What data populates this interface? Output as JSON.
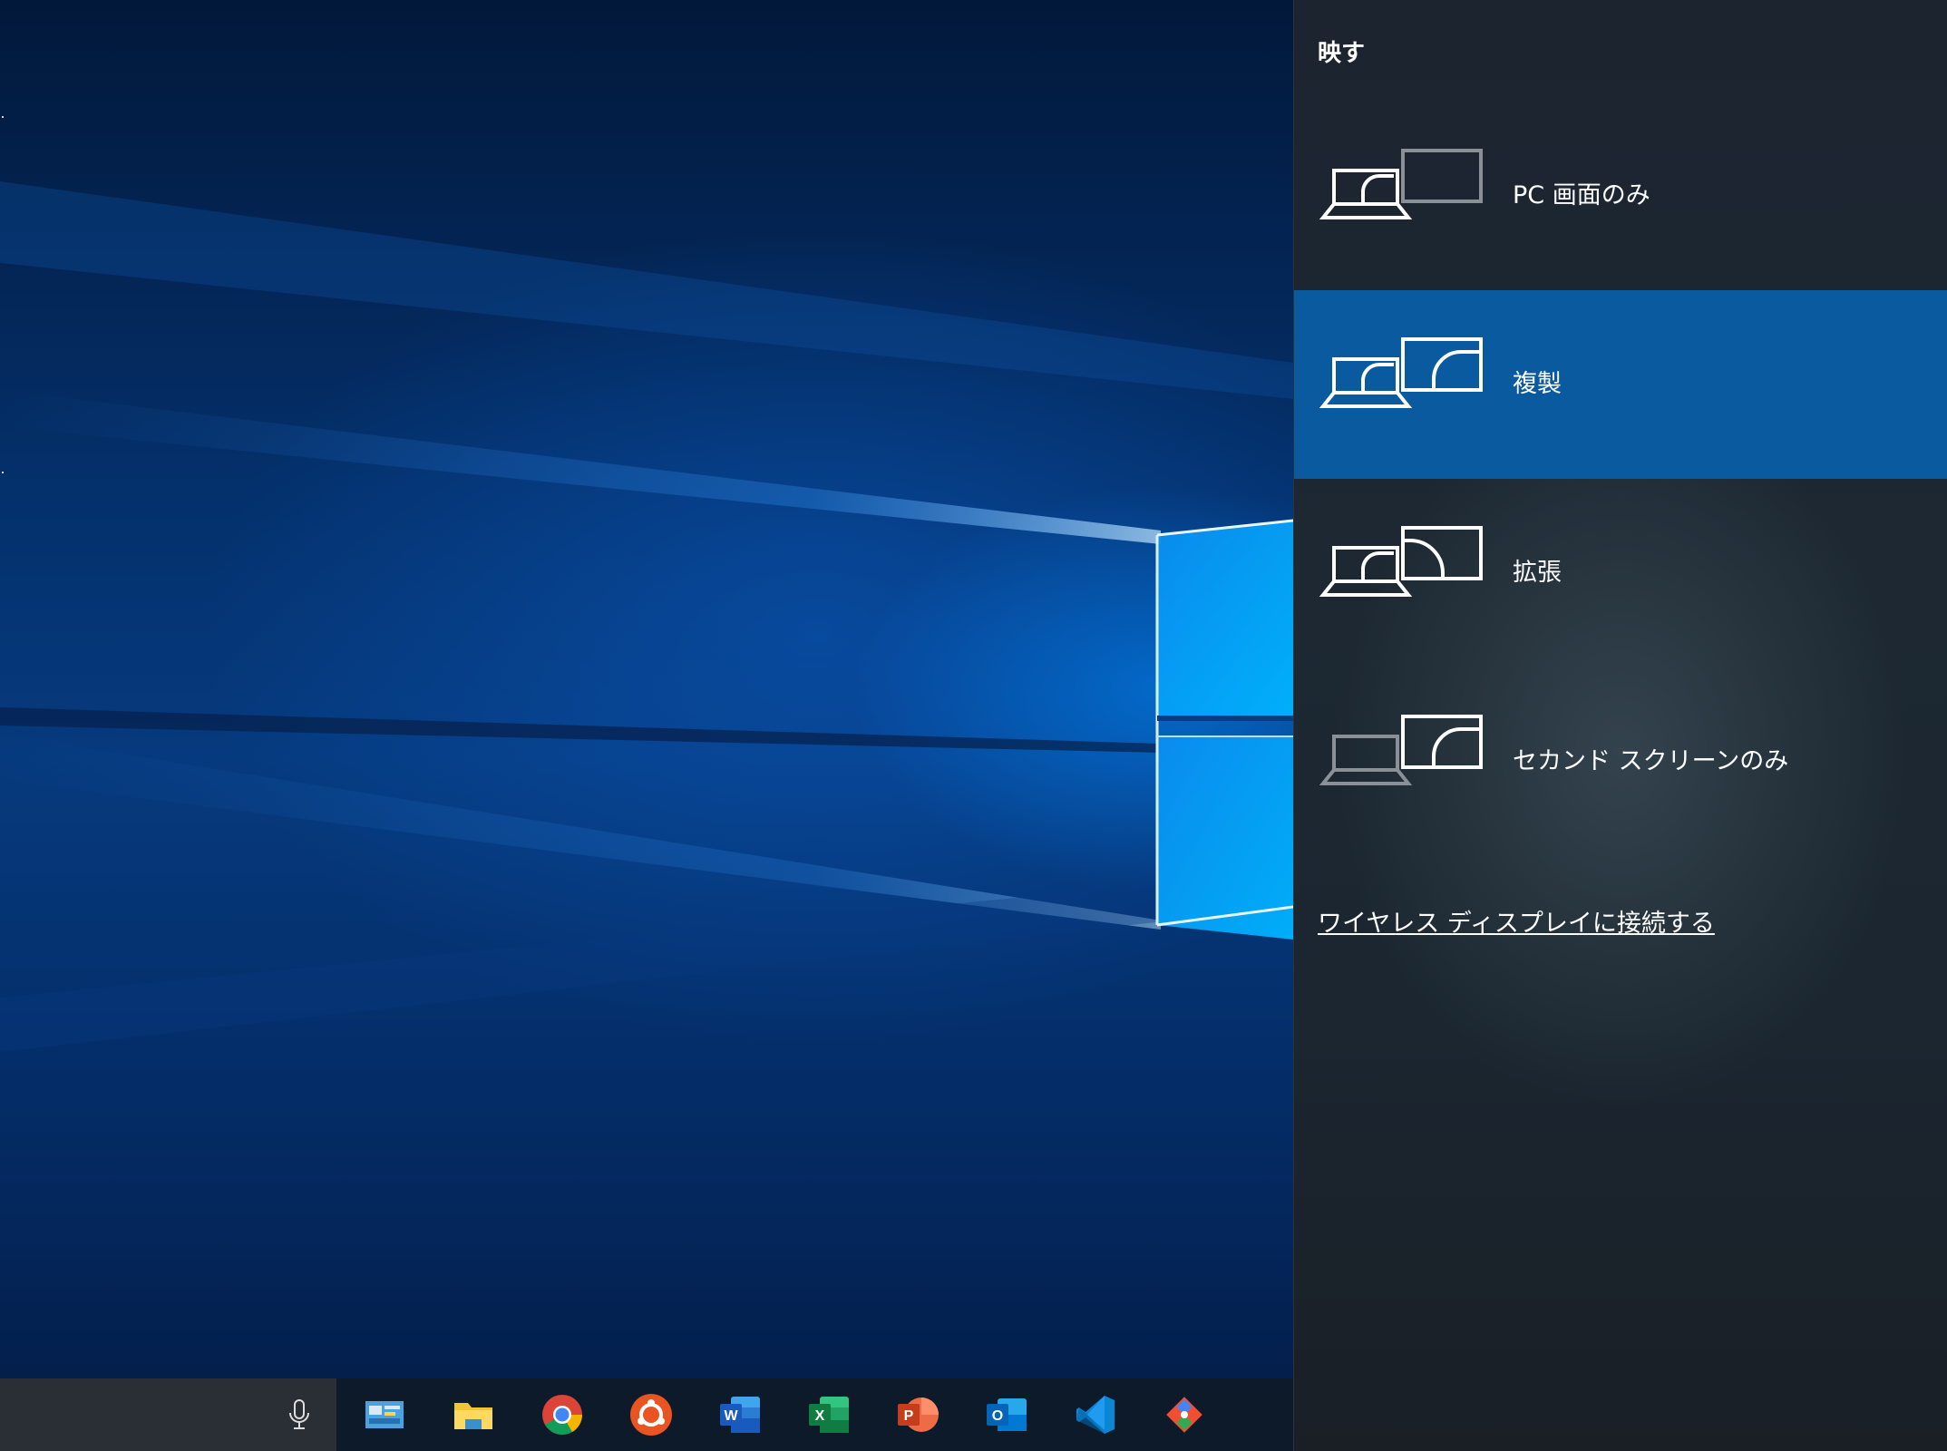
{
  "panel": {
    "title": "映す",
    "options": [
      {
        "label": "PC 画面のみ",
        "icon": "pc-screen-only-icon",
        "selected": false
      },
      {
        "label": "複製",
        "icon": "duplicate-icon",
        "selected": true
      },
      {
        "label": "拡張",
        "icon": "extend-icon",
        "selected": false
      },
      {
        "label": "セカンド スクリーンのみ",
        "icon": "second-screen-only-icon",
        "selected": false
      }
    ],
    "wireless_link": "ワイヤレス ディスプレイに接続する"
  },
  "taskbar": {
    "search_icon": "microphone-icon",
    "apps": [
      {
        "name": "control-panel-icon",
        "color": "#3a8fd0"
      },
      {
        "name": "file-explorer-icon",
        "color": "#f3c535"
      },
      {
        "name": "chrome-icon",
        "color": "#4285f4"
      },
      {
        "name": "ubuntu-icon",
        "color": "#e95420"
      },
      {
        "name": "word-icon",
        "color": "#2b5797"
      },
      {
        "name": "excel-icon",
        "color": "#1e7145"
      },
      {
        "name": "powerpoint-icon",
        "color": "#d24726"
      },
      {
        "name": "outlook-icon",
        "color": "#0072c6"
      },
      {
        "name": "vscode-icon",
        "color": "#0a86d4"
      },
      {
        "name": "git-icon",
        "color": "#f14e32"
      }
    ]
  },
  "colors": {
    "selected_highlight": "#0a5aa0",
    "panel_background": "#1c2430"
  }
}
